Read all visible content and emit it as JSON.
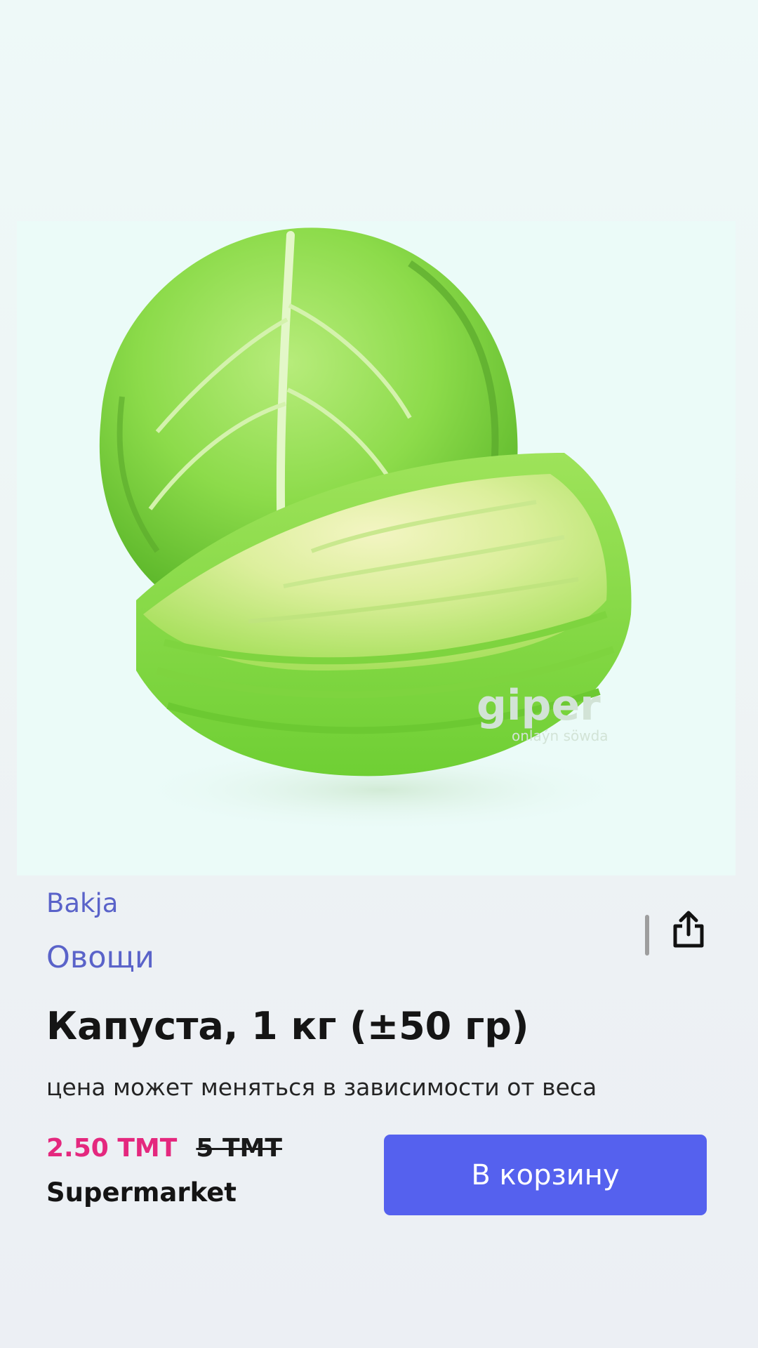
{
  "product": {
    "image_icon": "cabbage-image",
    "watermark": {
      "brand": "giper",
      "tagline": "onlaýn söwda"
    },
    "category": "Bakja",
    "subcategory": "Овощи",
    "title": "Капуста, 1 кг (±50 гр)",
    "note": "цена может меняться в зависимости от веса",
    "price_current": "2.50 TMT",
    "price_old": "5 TMT",
    "store": "Supermarket"
  },
  "actions": {
    "share_icon": "share-icon",
    "add_to_cart_label": "В корзину"
  },
  "colors": {
    "accent": "#5561ee",
    "category_text": "#5a63c9",
    "price": "#e4287e"
  }
}
